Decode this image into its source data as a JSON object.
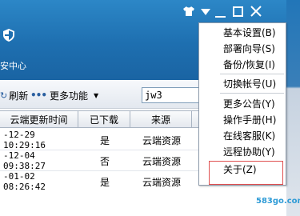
{
  "header": {
    "center_label": "安中心",
    "colors": {
      "primary": "#1e6fb0",
      "text": "#ffffff"
    }
  },
  "toolbar": {
    "refresh_label": "刷新",
    "more_label": "更多功能",
    "search_value": "jw3"
  },
  "table": {
    "columns": [
      "云端更新时间",
      "已下载",
      "来源"
    ],
    "rows": [
      {
        "time": "-12-29 10:29:16",
        "downloaded": "是",
        "source": "云端资源"
      },
      {
        "time": "-12-04 09:38:27",
        "downloaded": "否",
        "source": "云端资源"
      },
      {
        "time": "-01-02 08:26:42",
        "downloaded": "是",
        "source": "云端资源"
      }
    ]
  },
  "menu": {
    "items": [
      {
        "label": "基本设置(B)"
      },
      {
        "label": "部署向导(S)"
      },
      {
        "label": "备份/恢复(I)"
      },
      {
        "label": "切换帐号(U)"
      },
      {
        "label": "更多公告(Y)"
      },
      {
        "label": "操作手册(H)"
      },
      {
        "label": "在线客服(K)"
      },
      {
        "label": "远程协助(Y)"
      },
      {
        "label": "关于(Z)"
      }
    ],
    "highlight_color": "#e05050"
  },
  "watermark": "583go.com"
}
